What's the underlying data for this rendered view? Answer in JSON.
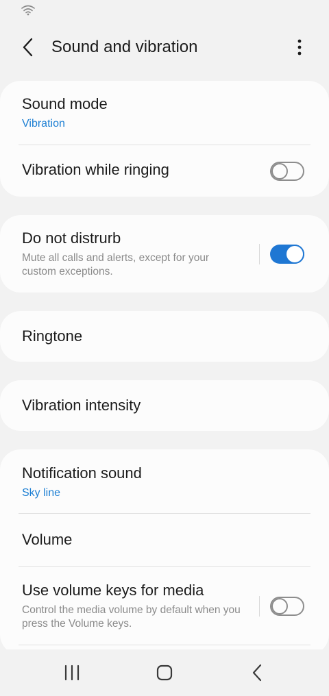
{
  "app_bar": {
    "title": "Sound and vibration"
  },
  "icons": {
    "status": "wifi-icon",
    "back": "back-arrow-icon",
    "more": "more-options-icon",
    "nav_recents": "recent-apps-icon",
    "nav_home": "home-icon",
    "nav_back": "nav-back-icon"
  },
  "colors": {
    "accent": "#1f77d3",
    "link_text": "#1d7fd3",
    "background": "#f2f2f2",
    "card": "#fcfcfc"
  },
  "sections": {
    "sound_mode": {
      "title": "Sound mode",
      "value": "Vibration"
    },
    "vibration_while_ringing": {
      "title": "Vibration while ringing",
      "enabled": false
    },
    "do_not_disturb": {
      "title": "Do not distrurb",
      "description": "Mute all calls and alerts, except for your custom exceptions.",
      "enabled": true
    },
    "ringtone": {
      "title": "Ringtone"
    },
    "vibration_intensity": {
      "title": "Vibration intensity"
    },
    "notification_sound": {
      "title": "Notification sound",
      "value": "Sky line"
    },
    "volume": {
      "title": "Volume"
    },
    "volume_keys_media": {
      "title": "Use volume keys for media",
      "description": "Control the media volume by default when you press the Volume keys.",
      "enabled": false
    }
  }
}
